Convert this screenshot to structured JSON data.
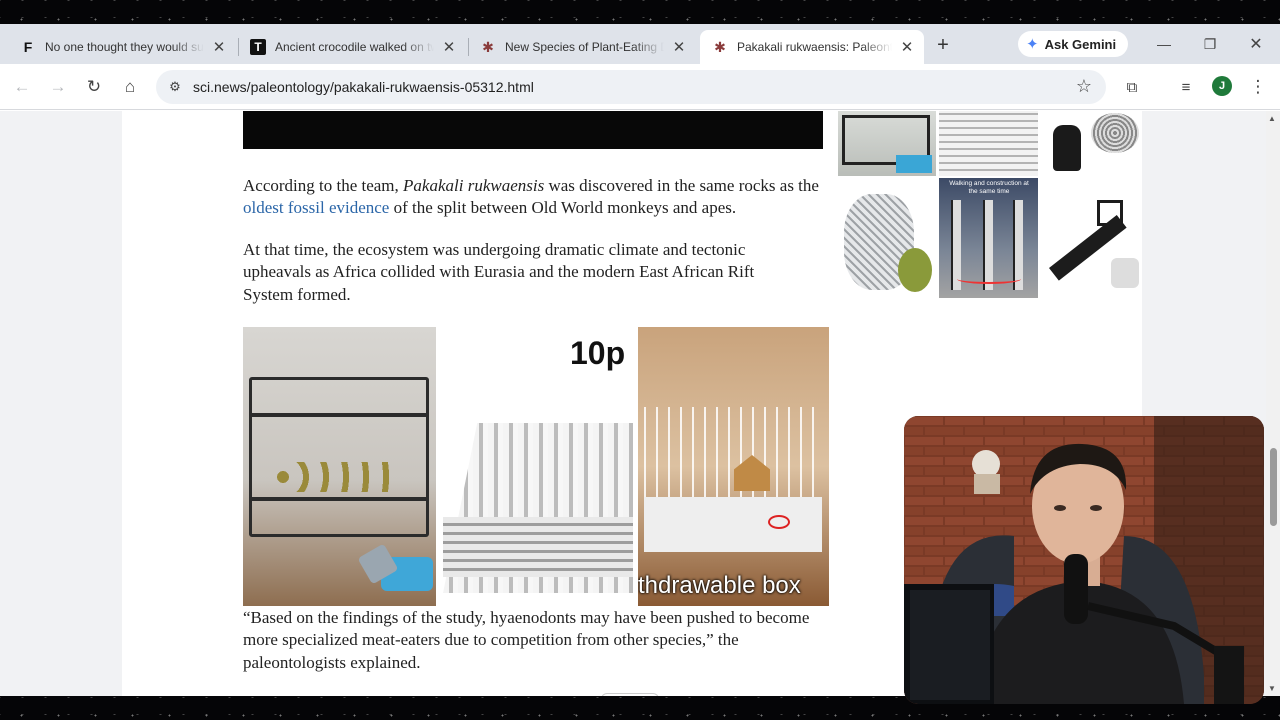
{
  "browser": {
    "tabs": [
      {
        "favicon": "F",
        "title": "No one thought they would survive",
        "active": false
      },
      {
        "favicon": "T",
        "title": "Ancient crocodile walked on two legs",
        "active": false
      },
      {
        "favicon": "sci-news-icon",
        "title": "New Species of Plant-Eating Dinosaur",
        "active": false
      },
      {
        "favicon": "sci-news-icon",
        "title": "Pakakali rukwaensis: Paleontologists",
        "active": true
      }
    ],
    "gemini_label": "Ask Gemini",
    "url": "sci.news/paleontology/pakakali-rukwaensis-05312.html",
    "profile_initial": "J"
  },
  "article": {
    "p1_pre": "According to the team, ",
    "p1_italic": "Pakakali rukwaensis",
    "p1_mid": " was discovered in the same rocks as the ",
    "p1_link": "oldest fossil evidence",
    "p1_post": " of the split between Old World monkeys and apes.",
    "p2": "At that time, the ecosystem was undergoing dramatic climate and tectonic upheavals as Africa collided with Eurasia and the modern East African Rift System formed.",
    "p3": "“Based on the findings of the study, hyaenodonts may have been pushed to become more specialized meat-eaters due to competition from other species,” the paleontologists explained."
  },
  "ads": {
    "banner_text_top": "10p",
    "banner_text_bottom": "thdrawable box",
    "sidebar_ad_caption": "Walking and construction at the same time"
  },
  "colors": {
    "link": "#2b66a8",
    "tabstrip": "#dfe3ea",
    "omnibox": "#eef1f5"
  }
}
